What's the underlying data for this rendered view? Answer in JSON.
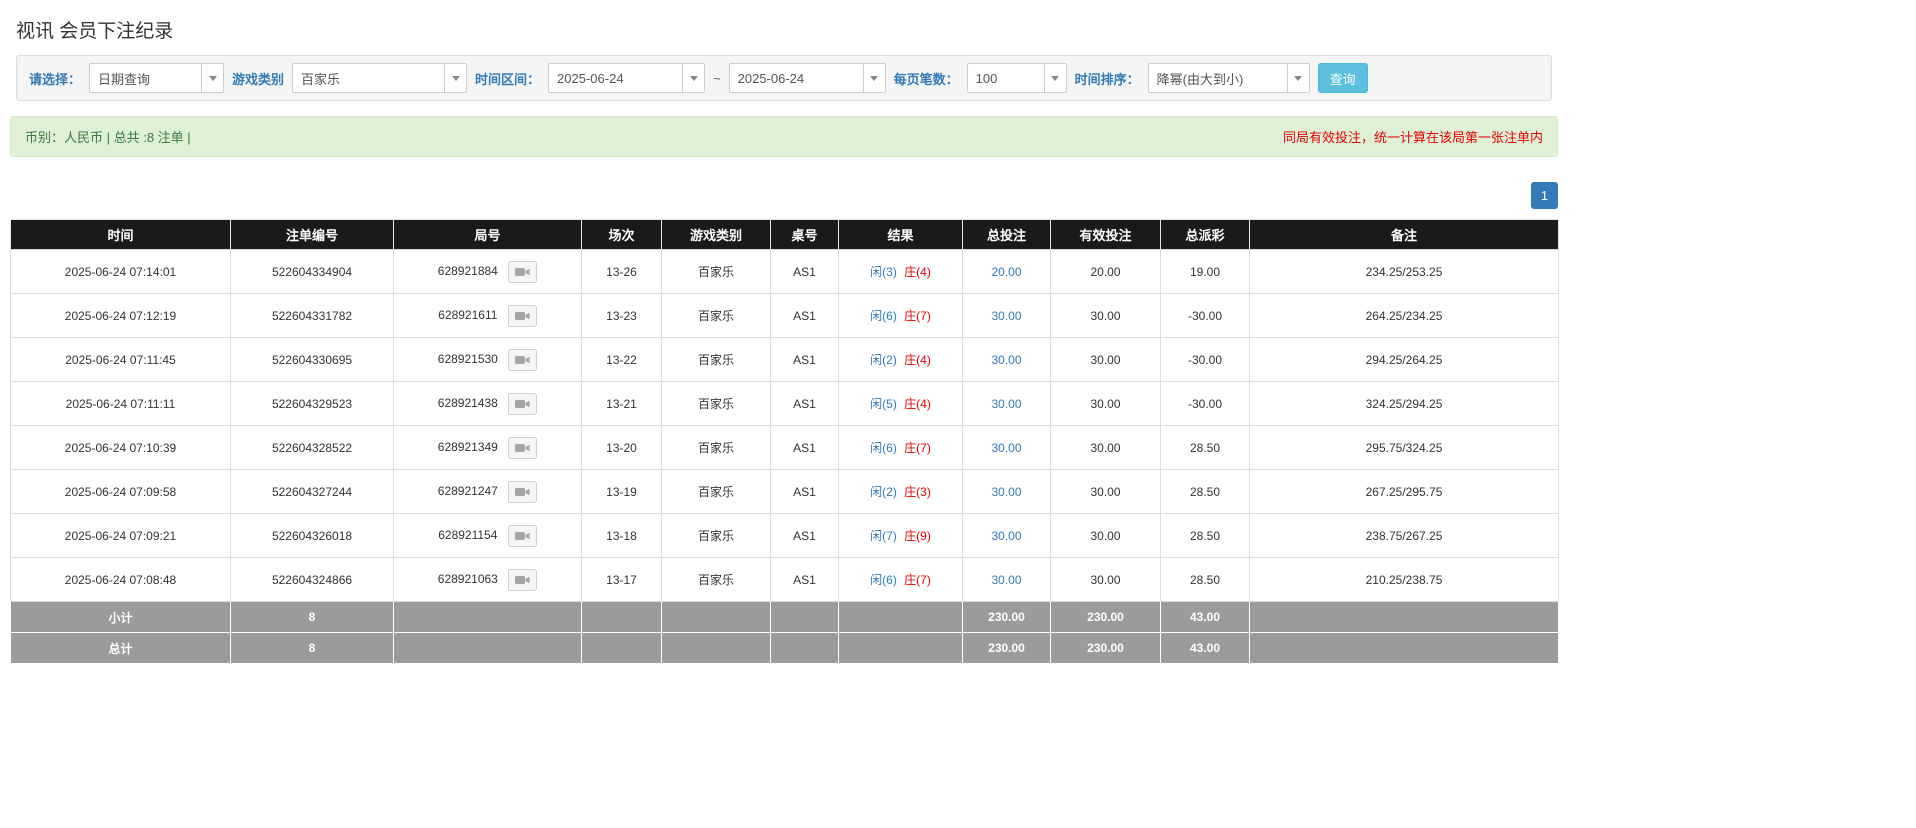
{
  "page": {
    "title": "视讯 会员下注纪录"
  },
  "filters": {
    "select_label": "请选择：",
    "select_value": "日期查询",
    "game_type_label": "游戏类别",
    "game_type_value": "百家乐",
    "time_range_label": "时间区间：",
    "time_from": "2025-06-24",
    "tilde": "~",
    "time_to": "2025-06-24",
    "page_size_label": "每页笔数：",
    "page_size_value": "100",
    "sort_label": "时间排序：",
    "sort_value": "降幂(由大到小)",
    "search_button": "查询"
  },
  "summary": {
    "left": "币别：人民币 | 总共 :8 注单 |",
    "right": "同局有效投注，统一计算在该局第一张注单内"
  },
  "pagination": {
    "page": "1"
  },
  "colors": {
    "accent_blue": "#337ab7",
    "info_button": "#5bc0de",
    "negative_red": "#e60000",
    "header_black": "#1a1a1a",
    "footer_gray": "#9b9b9b",
    "summary_green_bg": "#dff0d8"
  },
  "table": {
    "headers": [
      "时间",
      "注单编号",
      "局号",
      "场次",
      "游戏类别",
      "桌号",
      "结果",
      "总投注",
      "有效投注",
      "总派彩",
      "备注"
    ],
    "rows": [
      {
        "time": "2025-06-24 07:14:01",
        "bet_id": "522604334904",
        "round": "628921884",
        "session": "13-26",
        "game": "百家乐",
        "table_no": "AS1",
        "result_xian": "闲(3)",
        "result_zhuang": "庄(4)",
        "total_bet": "20.00",
        "valid_bet": "20.00",
        "payout": "19.00",
        "remark": "234.25/253.25"
      },
      {
        "time": "2025-06-24 07:12:19",
        "bet_id": "522604331782",
        "round": "628921611",
        "session": "13-23",
        "game": "百家乐",
        "table_no": "AS1",
        "result_xian": "闲(6)",
        "result_zhuang": "庄(7)",
        "total_bet": "30.00",
        "valid_bet": "30.00",
        "payout": "-30.00",
        "remark": "264.25/234.25"
      },
      {
        "time": "2025-06-24 07:11:45",
        "bet_id": "522604330695",
        "round": "628921530",
        "session": "13-22",
        "game": "百家乐",
        "table_no": "AS1",
        "result_xian": "闲(2)",
        "result_zhuang": "庄(4)",
        "total_bet": "30.00",
        "valid_bet": "30.00",
        "payout": "-30.00",
        "remark": "294.25/264.25"
      },
      {
        "time": "2025-06-24 07:11:11",
        "bet_id": "522604329523",
        "round": "628921438",
        "session": "13-21",
        "game": "百家乐",
        "table_no": "AS1",
        "result_xian": "闲(5)",
        "result_zhuang": "庄(4)",
        "total_bet": "30.00",
        "valid_bet": "30.00",
        "payout": "-30.00",
        "remark": "324.25/294.25"
      },
      {
        "time": "2025-06-24 07:10:39",
        "bet_id": "522604328522",
        "round": "628921349",
        "session": "13-20",
        "game": "百家乐",
        "table_no": "AS1",
        "result_xian": "闲(6)",
        "result_zhuang": "庄(7)",
        "total_bet": "30.00",
        "valid_bet": "30.00",
        "payout": "28.50",
        "remark": "295.75/324.25"
      },
      {
        "time": "2025-06-24 07:09:58",
        "bet_id": "522604327244",
        "round": "628921247",
        "session": "13-19",
        "game": "百家乐",
        "table_no": "AS1",
        "result_xian": "闲(2)",
        "result_zhuang": "庄(3)",
        "total_bet": "30.00",
        "valid_bet": "30.00",
        "payout": "28.50",
        "remark": "267.25/295.75"
      },
      {
        "time": "2025-06-24 07:09:21",
        "bet_id": "522604326018",
        "round": "628921154",
        "session": "13-18",
        "game": "百家乐",
        "table_no": "AS1",
        "result_xian": "闲(7)",
        "result_zhuang": "庄(9)",
        "total_bet": "30.00",
        "valid_bet": "30.00",
        "payout": "28.50",
        "remark": "238.75/267.25"
      },
      {
        "time": "2025-06-24 07:08:48",
        "bet_id": "522604324866",
        "round": "628921063",
        "session": "13-17",
        "game": "百家乐",
        "table_no": "AS1",
        "result_xian": "闲(6)",
        "result_zhuang": "庄(7)",
        "total_bet": "30.00",
        "valid_bet": "30.00",
        "payout": "28.50",
        "remark": "210.25/238.75"
      }
    ],
    "subtotal": {
      "label": "小计",
      "count": "8",
      "total_bet": "230.00",
      "valid_bet": "230.00",
      "payout": "43.00"
    },
    "total": {
      "label": "总计",
      "count": "8",
      "total_bet": "230.00",
      "valid_bet": "230.00",
      "payout": "43.00"
    }
  }
}
